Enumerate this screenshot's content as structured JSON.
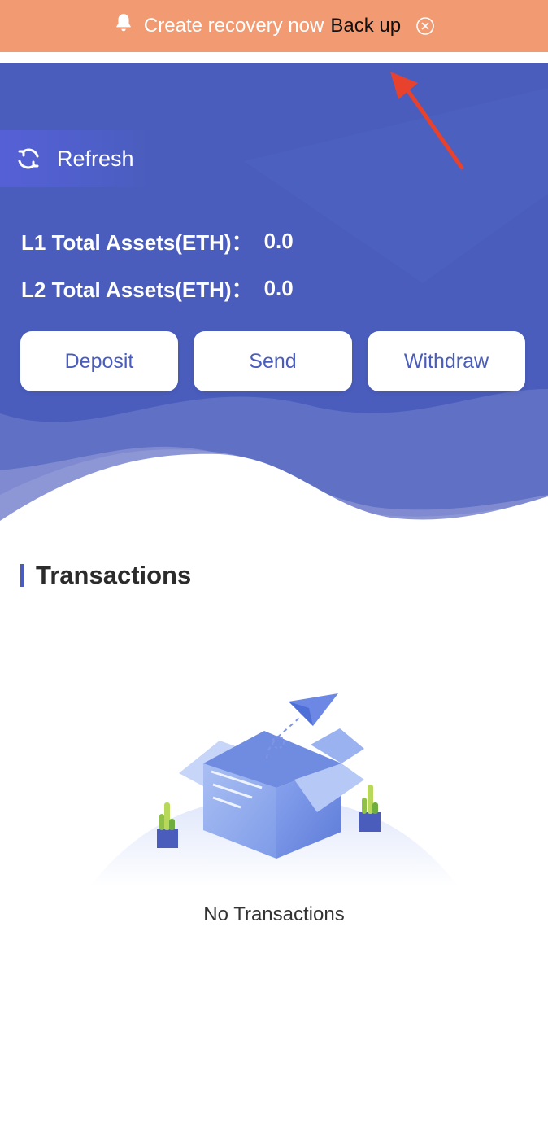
{
  "notice": {
    "message": "Create recovery now",
    "action_label": "Back up",
    "bell_icon": "bell-icon",
    "close_icon": "close-circle-icon",
    "background": "#f29b73"
  },
  "hero": {
    "background": "#4a5dbc",
    "refresh_label": "Refresh",
    "refresh_icon": "refresh-icon",
    "assets": [
      {
        "label": "L1 Total Assets(ETH)：",
        "value": "0.0"
      },
      {
        "label": "L2 Total Assets(ETH)：",
        "value": "0.0"
      }
    ],
    "actions": {
      "deposit": "Deposit",
      "send": "Send",
      "withdraw": "Withdraw"
    }
  },
  "annotation": {
    "arrow_color": "#e8412c"
  },
  "transactions": {
    "title": "Transactions",
    "empty_text": "No Transactions",
    "empty_icon": "empty-box-paper-plane-illustration"
  }
}
